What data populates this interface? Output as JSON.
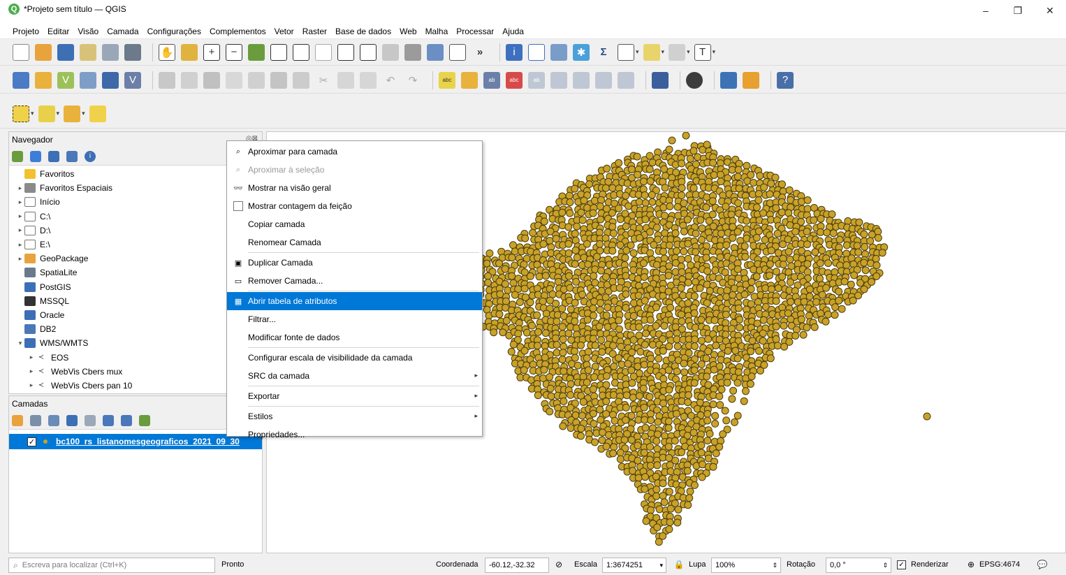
{
  "window": {
    "title": "*Projeto sem título — QGIS",
    "minimize": "–",
    "maximize": "❐",
    "close": "✕"
  },
  "menubar": [
    "Projeto",
    "Editar",
    "Visão",
    "Camada",
    "Configurações",
    "Complementos",
    "Vetor",
    "Raster",
    "Base de dados",
    "Web",
    "Malha",
    "Processar",
    "Ajuda"
  ],
  "navigator": {
    "title": "Navegador",
    "controls": "◎⊠",
    "items": [
      {
        "label": "Favoritos",
        "icon": "star-icon",
        "arrow": ""
      },
      {
        "label": "Favoritos Espaciais",
        "icon": "spatial-bookmarks-icon",
        "arrow": "▸"
      },
      {
        "label": "Início",
        "icon": "home-folder-icon",
        "arrow": "▸"
      },
      {
        "label": "C:\\",
        "icon": "drive-icon",
        "arrow": "▸"
      },
      {
        "label": "D:\\",
        "icon": "drive-icon",
        "arrow": "▸"
      },
      {
        "label": "E:\\",
        "icon": "drive-icon",
        "arrow": "▸"
      },
      {
        "label": "GeoPackage",
        "icon": "geopackage-icon",
        "arrow": "▸"
      },
      {
        "label": "SpatiaLite",
        "icon": "spatialite-icon",
        "arrow": ""
      },
      {
        "label": "PostGIS",
        "icon": "postgis-icon",
        "arrow": ""
      },
      {
        "label": "MSSQL",
        "icon": "mssql-icon",
        "arrow": ""
      },
      {
        "label": "Oracle",
        "icon": "oracle-icon",
        "arrow": ""
      },
      {
        "label": "DB2",
        "icon": "db2-icon",
        "arrow": ""
      },
      {
        "label": "WMS/WMTS",
        "icon": "wms-icon",
        "arrow": "▾"
      },
      {
        "label": "EOS",
        "icon": "wms-layer-icon",
        "arrow": "▸",
        "child": true
      },
      {
        "label": "WebVis Cbers mux",
        "icon": "wms-layer-icon",
        "arrow": "▸",
        "child": true
      },
      {
        "label": "WebVis Cbers pan 10",
        "icon": "wms-layer-icon",
        "arrow": "▸",
        "child": true
      }
    ]
  },
  "layers": {
    "title": "Camadas",
    "layer_name": "bc100_rs_listanomesgeograficos_2021_09_30",
    "checked": "✓"
  },
  "context_menu": [
    {
      "label": "Aproximar para camada",
      "icon": "zoom-to-layer-icon",
      "glyph": "⌕",
      "disabled": false
    },
    {
      "label": "Aproximar à seleção",
      "icon": "zoom-to-selection-icon",
      "glyph": "⌕",
      "disabled": true
    },
    {
      "label": "Mostrar na visão geral",
      "icon": "overview-icon",
      "glyph": "👓",
      "disabled": false
    },
    {
      "label": "Mostrar contagem da feição",
      "icon": "checkbox-icon",
      "glyph": "",
      "disabled": false
    },
    {
      "label": "Copiar camada",
      "icon": "",
      "glyph": "",
      "disabled": false
    },
    {
      "label": "Renomear Camada",
      "icon": "",
      "glyph": "",
      "disabled": false,
      "sep_after": true
    },
    {
      "label": "Duplicar Camada",
      "icon": "duplicate-icon",
      "glyph": "▣",
      "disabled": false
    },
    {
      "label": "Remover Camada...",
      "icon": "remove-layer-icon",
      "glyph": "▭",
      "disabled": false,
      "sep_after": true
    },
    {
      "label": "Abrir tabela de atributos",
      "icon": "attribute-table-icon",
      "glyph": "▦",
      "disabled": false,
      "active": true
    },
    {
      "label": "Filtrar...",
      "icon": "",
      "glyph": "",
      "disabled": false
    },
    {
      "label": "Modificar fonte de dados",
      "icon": "",
      "glyph": "",
      "disabled": false,
      "sep_after": true
    },
    {
      "label": "Configurar escala de visibilidade da camada",
      "icon": "",
      "glyph": "",
      "disabled": false
    },
    {
      "label": "SRC da camada",
      "icon": "",
      "glyph": "",
      "disabled": false,
      "submenu": true,
      "sep_after": true
    },
    {
      "label": "Exportar",
      "icon": "",
      "glyph": "",
      "disabled": false,
      "submenu": true,
      "sep_after": true
    },
    {
      "label": "Estilos",
      "icon": "",
      "glyph": "",
      "disabled": false,
      "submenu": true
    },
    {
      "label": "Propriedades...",
      "icon": "",
      "glyph": "",
      "disabled": false
    }
  ],
  "statusbar": {
    "locator_placeholder": "Escreva para localizar (Ctrl+K)",
    "message": "Pronto",
    "coord_label": "Coordenada",
    "coord_value": "-60.12,-32.32",
    "scale_label": "Escala",
    "scale_value": "1:3674251",
    "magnifier_label": "Lupa",
    "magnifier_value": "100%",
    "rotation_label": "Rotação",
    "rotation_value": "0,0 °",
    "render_label": "Renderizar",
    "render_checked": "✓",
    "crs": "EPSG:4674"
  },
  "colors": {
    "point_fill": "#c9a227",
    "point_stroke": "#4a3c10",
    "selection": "#0078d7"
  }
}
